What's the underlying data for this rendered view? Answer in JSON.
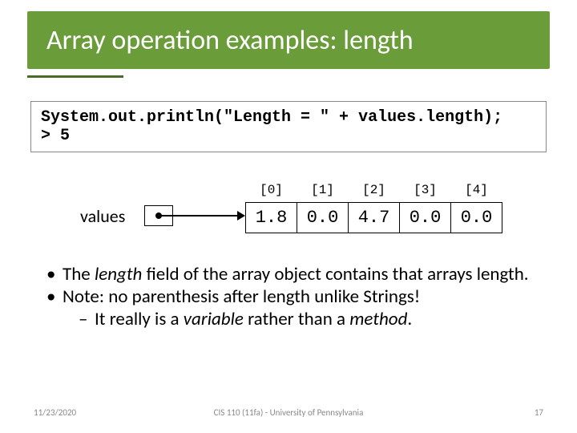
{
  "title": "Array operation examples: length",
  "code": {
    "line1": "System.out.println(\"Length = \" + values.length);",
    "line2": "> 5"
  },
  "diagram": {
    "var_name": "values",
    "indices": [
      "[0]",
      "[1]",
      "[2]",
      "[3]",
      "[4]"
    ],
    "cells": [
      "1.8",
      "0.0",
      "4.7",
      "0.0",
      "0.0"
    ]
  },
  "bullets": {
    "b1_pre": "The ",
    "b1_em": "length",
    "b1_post": " field of the array object contains that arrays length.",
    "b2": "Note: no parenthesis after length unlike Strings!",
    "b2_sub_pre": "It really is a ",
    "b2_sub_em1": "variable",
    "b2_sub_mid": " rather than a ",
    "b2_sub_em2": "method",
    "b2_sub_end": "."
  },
  "footer": {
    "date": "11/23/2020",
    "credit": "CIS 110 (11fa) - University of Pennsylvania",
    "page": "17"
  }
}
